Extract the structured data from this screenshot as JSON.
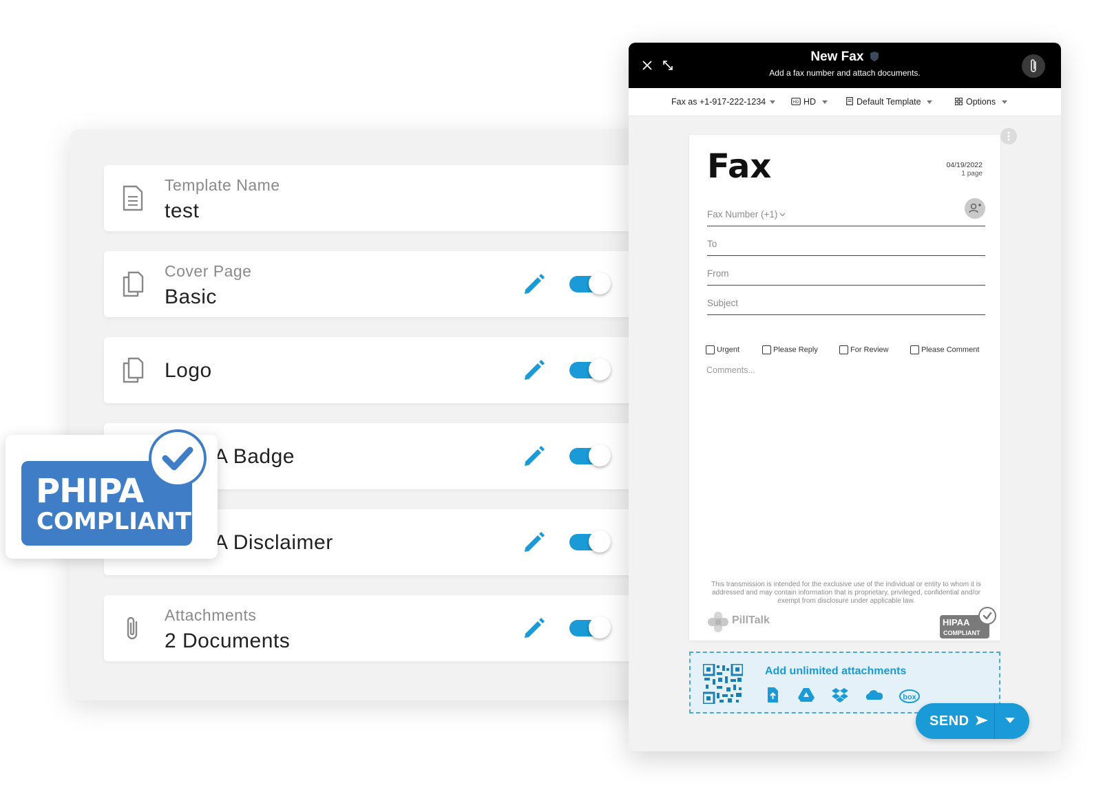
{
  "template_panel": {
    "rows": [
      {
        "label": "Template Name",
        "value": "test",
        "icon": "document-icon"
      },
      {
        "label": "Cover Page",
        "value": "Basic",
        "icon": "copy-pages-icon",
        "enabled": true
      },
      {
        "value": "Logo",
        "icon": "copy-pages-icon",
        "enabled": true
      },
      {
        "value": "A Badge",
        "icon": "copy-pages-icon",
        "enabled": true
      },
      {
        "value": "A Disclaimer",
        "icon": "copy-pages-icon",
        "enabled": true
      },
      {
        "label": "Attachments",
        "value": "2 Documents",
        "icon": "paperclip-icon",
        "enabled": true
      }
    ]
  },
  "phipa_badge": {
    "line1": "PHIPA",
    "line2": "COMPLIANT"
  },
  "fax_window": {
    "title": "New Fax",
    "subtitle": "Add a fax number and attach documents.",
    "toolbar": {
      "fax_as": "Fax as +1-917-222-1234",
      "quality": "HD",
      "template": "Default Template",
      "options": "Options"
    },
    "page": {
      "heading": "Fax",
      "date": "04/19/2022",
      "pages": "1 page",
      "fields": {
        "fax_number": "Fax Number (+1)",
        "to": "To",
        "from": "From",
        "subject": "Subject"
      },
      "checkboxes": [
        "Urgent",
        "Please Reply",
        "For Review",
        "Please Comment"
      ],
      "comments_placeholder": "Comments...",
      "disclaimer": "This transmission is intended for the exclusive use of the individual or entity to whom it is addressed and may contain information that is proprietary, privileged, confidential and/or exempt from disclosure under applicable law.",
      "brand": "PillTalk",
      "hipaa_line1": "HIPAA",
      "hipaa_line2": "COMPLIANT"
    },
    "attachments": {
      "title": "Add unlimited attachments",
      "sources": [
        "upload-icon",
        "google-drive-icon",
        "dropbox-icon",
        "onedrive-icon",
        "box-icon"
      ]
    },
    "send_label": "SEND"
  },
  "colors": {
    "accent": "#1a9ad6",
    "phipa_blue": "#3f7ec7",
    "header_black": "#000000"
  }
}
